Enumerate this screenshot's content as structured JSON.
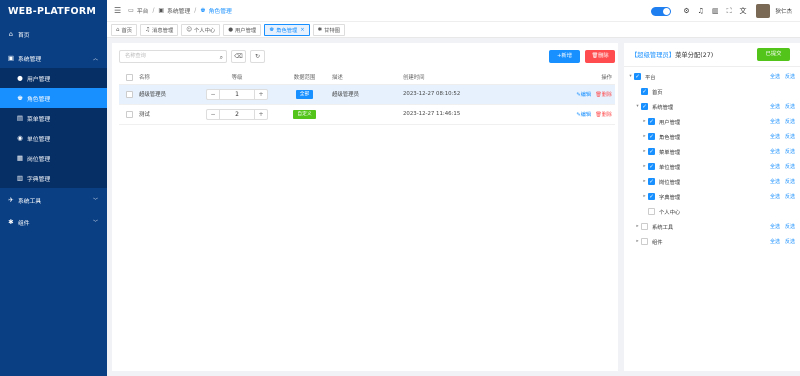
{
  "app": {
    "logo": "WEB-PLATFORM"
  },
  "sidebar": {
    "items": [
      {
        "label": "首页",
        "icon": "home-icon"
      },
      {
        "label": "系统管理",
        "icon": "system-icon"
      }
    ],
    "sub_items": [
      {
        "label": "用户管理",
        "icon": "user-icon"
      },
      {
        "label": "角色管理",
        "icon": "role-icon"
      },
      {
        "label": "菜单管理",
        "icon": "menu-icon"
      },
      {
        "label": "单位管理",
        "icon": "unit-icon"
      },
      {
        "label": "岗位管理",
        "icon": "post-icon"
      },
      {
        "label": "字典管理",
        "icon": "dict-icon"
      }
    ],
    "bottom_items": [
      {
        "label": "系统工具",
        "icon": "tools-icon"
      },
      {
        "label": "组件",
        "icon": "component-icon"
      }
    ]
  },
  "breadcrumb": [
    "平台",
    "系统管理",
    "角色管理"
  ],
  "user": {
    "name": "狄仁杰"
  },
  "tabs": [
    {
      "label": "首页"
    },
    {
      "label": "消息管理"
    },
    {
      "label": "个人中心"
    },
    {
      "label": "用户管理"
    },
    {
      "label": "角色管理"
    },
    {
      "label": "甘特图"
    }
  ],
  "toolbar": {
    "search_placeholder": "名称查询",
    "add_label": "+新增",
    "delete_label": "删除"
  },
  "table": {
    "headers": [
      "名称",
      "等级",
      "数据范围",
      "描述",
      "创建时间",
      "操作"
    ],
    "rows": [
      {
        "name": "超级管理员",
        "level": "1",
        "scope": "全部",
        "scope_color": "#1890ff",
        "desc": "超级管理员",
        "time": "2023-12-27 08:10:52",
        "edit": "编辑",
        "del": "删除",
        "selected": true
      },
      {
        "name": "测试",
        "level": "2",
        "scope": "自定义",
        "scope_color": "#52c41a",
        "desc": "",
        "time": "2023-12-27 11:46:15",
        "edit": "编辑",
        "del": "删除",
        "selected": false
      }
    ]
  },
  "right_panel": {
    "title_prefix": "【超级管理员】",
    "title_rest": "菜单分配(27)",
    "submit_label": "已提交",
    "select_all": "全选",
    "invert": "反选",
    "tree": [
      {
        "label": "平台",
        "checked": true,
        "expand": true
      },
      {
        "label": "首页",
        "checked": true,
        "expand": false
      },
      {
        "label": "系统管理",
        "checked": true,
        "expand": true
      },
      {
        "label": "用户管理",
        "checked": true,
        "expand": true
      },
      {
        "label": "角色管理",
        "checked": true,
        "expand": true
      },
      {
        "label": "菜单管理",
        "checked": true,
        "expand": true
      },
      {
        "label": "单位管理",
        "checked": true,
        "expand": true
      },
      {
        "label": "岗位管理",
        "checked": true,
        "expand": true
      },
      {
        "label": "字典管理",
        "checked": true,
        "expand": true
      },
      {
        "label": "个人中心",
        "checked": false,
        "expand": false
      },
      {
        "label": "系统工具",
        "checked": false,
        "expand": true
      },
      {
        "label": "组件",
        "checked": false,
        "expand": true
      }
    ]
  }
}
